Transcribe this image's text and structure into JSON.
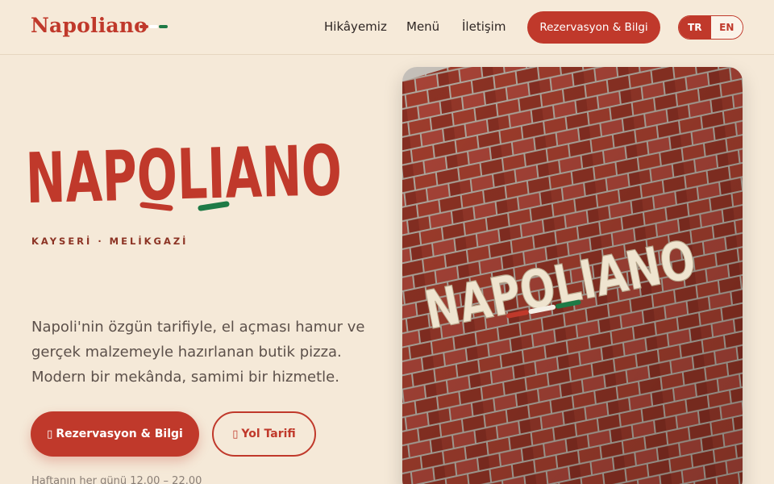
{
  "header": {
    "brand": "Napoliano",
    "nav": [
      "Hikâyemiz",
      "Menü",
      "İletişim"
    ],
    "cta_label": "Rezervasyon & Bilgi",
    "lang": {
      "active": "TR",
      "inactive": "EN"
    }
  },
  "hero": {
    "logo_text": "NAPOLIANO",
    "location": "KAYSERİ · MELİKGAZİ",
    "description": "Napoli'nin özgün tarifiyle, el açması hamur ve gerçek malzemeyle hazırlanan butik pizza. Modern bir mekânda, samimi bir hizmetle.",
    "primary_button": {
      "icon": "calendar-icon",
      "label": "Rezervasyon & Bilgi"
    },
    "secondary_button": {
      "icon": "map-pin-icon",
      "label": "Yol Tarifi"
    },
    "hours": "Haftanın her günü 12.00 – 22.00",
    "photo_sign_text": "NAPOLIANO"
  },
  "colors": {
    "accent": "#c0392b",
    "background": "#f5e9d8",
    "flag_red": "#c0392b",
    "flag_white": "#ffffff",
    "flag_green": "#1e7a46",
    "brick": "#9e3b2c"
  }
}
